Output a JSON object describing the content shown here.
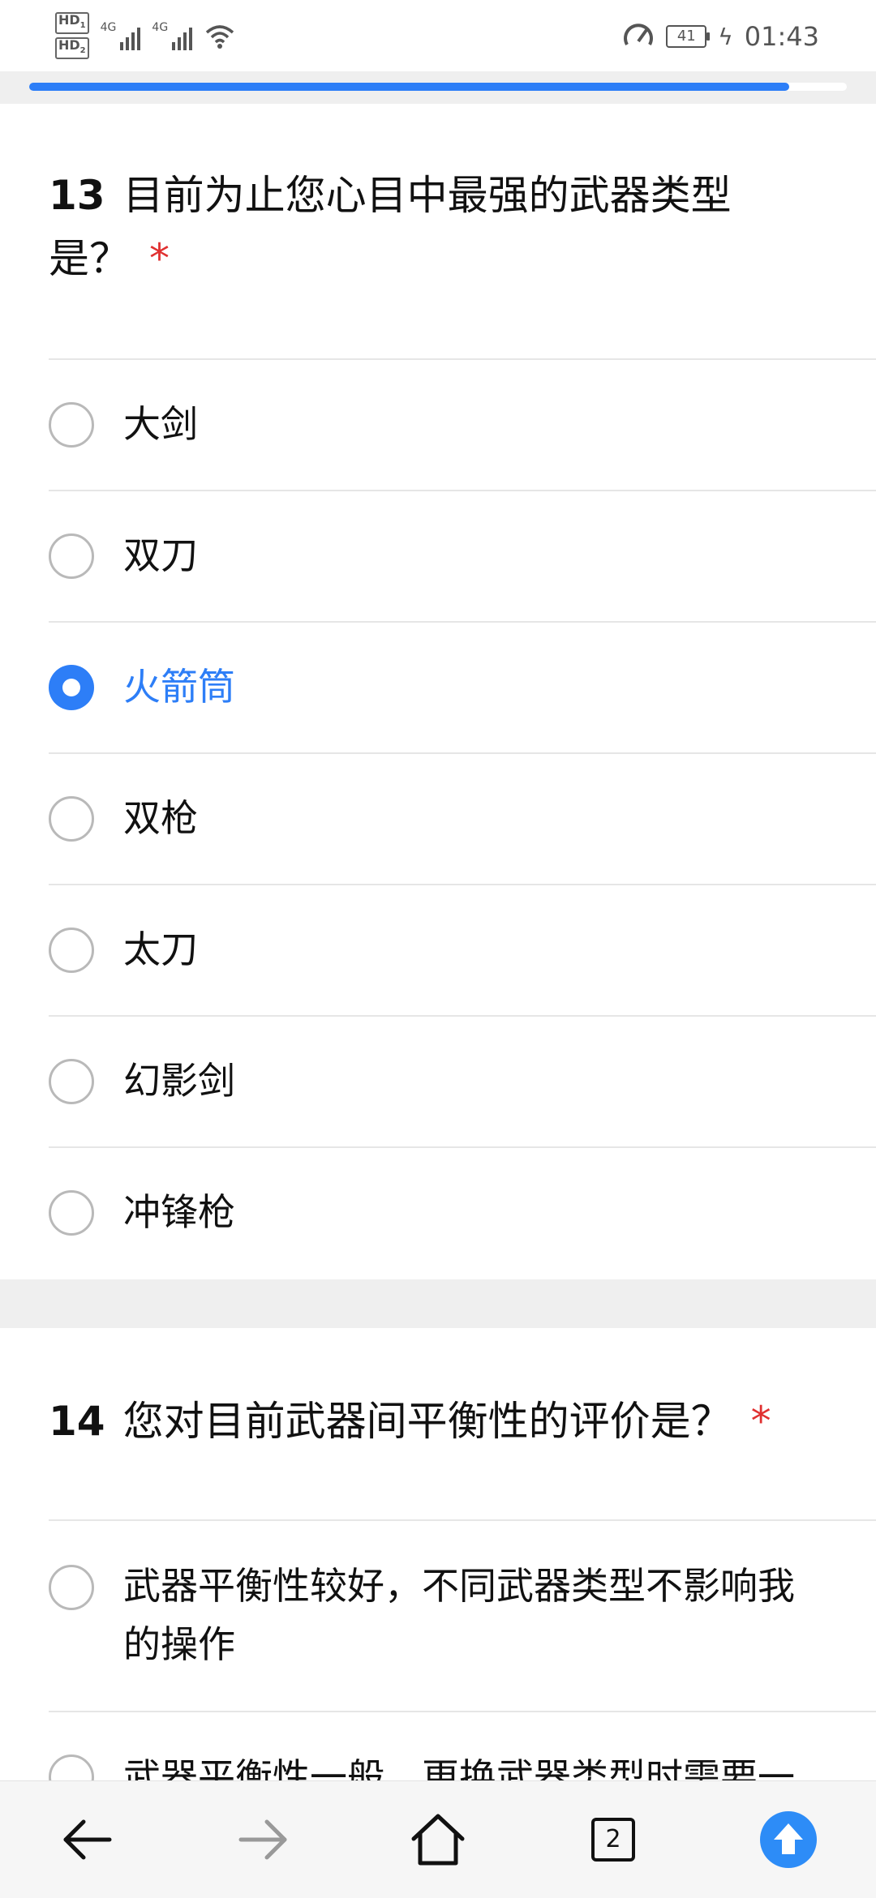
{
  "status_bar": {
    "sim1": "HD",
    "sim1_slot": "1",
    "sim2": "HD",
    "sim2_slot": "2",
    "network1": "4G",
    "network2": "4G",
    "battery": "41",
    "time": "01:43"
  },
  "progress": {
    "fraction": 0.93
  },
  "questions": [
    {
      "number": "13",
      "text": "目前为止您心目中最强的武器类型是？",
      "required_mark": "*",
      "options": [
        {
          "label": "大剑",
          "checked": false
        },
        {
          "label": "双刀",
          "checked": false
        },
        {
          "label": "火箭筒",
          "checked": true
        },
        {
          "label": "双枪",
          "checked": false
        },
        {
          "label": "太刀",
          "checked": false
        },
        {
          "label": "幻影剑",
          "checked": false
        },
        {
          "label": "冲锋枪",
          "checked": false
        }
      ]
    },
    {
      "number": "14",
      "text": "您对目前武器间平衡性的评价是？",
      "required_mark": "*",
      "options": [
        {
          "label": "武器平衡性较好，不同武器类型不影响我的操作",
          "checked": false
        },
        {
          "label": "武器平衡性一般，更换武器类型时需要一",
          "checked": false
        }
      ]
    }
  ],
  "bottom_nav": {
    "tab_count": "2",
    "icons": [
      "back-arrow-icon",
      "forward-arrow-icon",
      "home-icon",
      "tabs-icon",
      "upload-icon"
    ]
  },
  "colors": {
    "accent": "#2d7ef7",
    "required": "#e03030"
  }
}
